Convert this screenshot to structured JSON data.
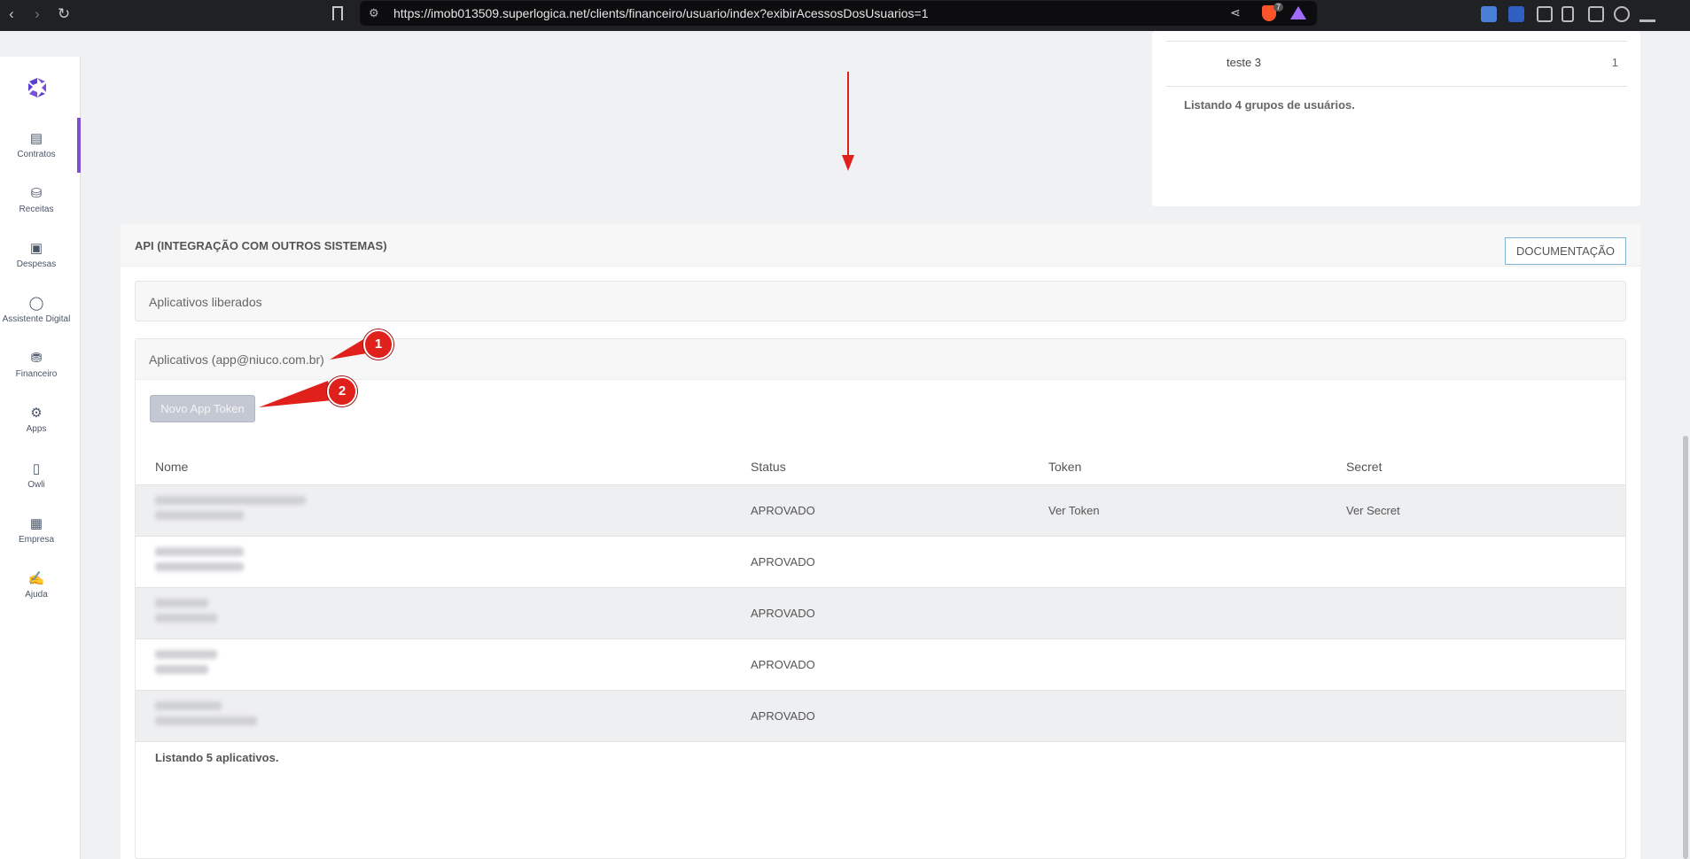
{
  "browser": {
    "url": "https://imob013509.superlogica.net/clients/financeiro/usuario/index?exibirAcessosDosUsuarios=1",
    "shield_count": "7"
  },
  "sidebar": {
    "items": [
      {
        "label": "Contratos",
        "icon": "contract-icon"
      },
      {
        "label": "Receitas",
        "icon": "income-icon"
      },
      {
        "label": "Despesas",
        "icon": "expense-icon"
      },
      {
        "label": "Assistente Digital",
        "icon": "chat-icon"
      },
      {
        "label": "Financeiro",
        "icon": "coins-icon"
      },
      {
        "label": "Apps",
        "icon": "gears-icon"
      },
      {
        "label": "Owli",
        "icon": "phone-icon"
      },
      {
        "label": "Empresa",
        "icon": "building-icon"
      },
      {
        "label": "Ajuda",
        "icon": "help-icon"
      }
    ]
  },
  "groups": {
    "row_name": "teste 3",
    "row_count": "1",
    "footer": "Listando 4 grupos de usuários."
  },
  "api": {
    "title": "API (INTEGRAÇÃO COM OUTROS SISTEMAS)",
    "doc_button": "DOCUMENTAÇÃO",
    "released_label": "Aplicativos liberados",
    "apps_label": "Aplicativos (app@niuco.com.br)",
    "new_token_button": "Novo App Token",
    "columns": {
      "name": "Nome",
      "status": "Status",
      "token": "Token",
      "secret": "Secret"
    },
    "rows": [
      {
        "status": "APROVADO",
        "token": "Ver Token",
        "secret": "Ver Secret"
      },
      {
        "status": "APROVADO",
        "token": "",
        "secret": ""
      },
      {
        "status": "APROVADO",
        "token": "",
        "secret": ""
      },
      {
        "status": "APROVADO",
        "token": "",
        "secret": ""
      },
      {
        "status": "APROVADO",
        "token": "",
        "secret": ""
      }
    ],
    "footer": "Listando 5 aplicativos."
  },
  "callouts": {
    "one": "1",
    "two": "2"
  },
  "colors": {
    "accent": "#7b4fd6",
    "callout": "#e0201a",
    "doc_border": "#7fb3d5"
  }
}
